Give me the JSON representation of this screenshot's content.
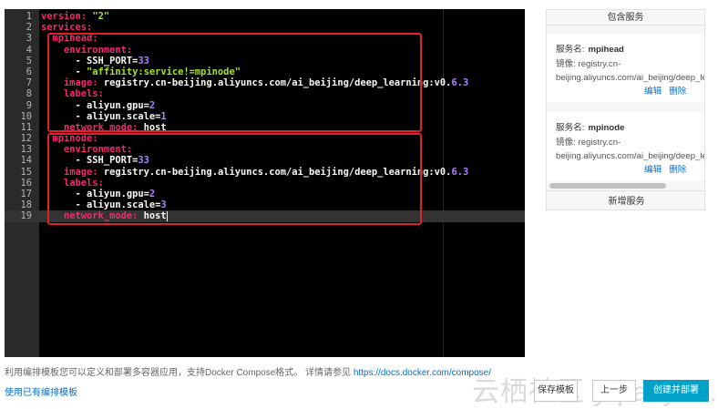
{
  "editor": {
    "lines": [
      {
        "num": "1",
        "segments": [
          {
            "c": "k",
            "t": "version: "
          },
          {
            "c": "s",
            "t": "\"2\""
          }
        ]
      },
      {
        "num": "2",
        "segments": [
          {
            "c": "k",
            "t": "services:"
          }
        ]
      },
      {
        "num": "3",
        "segments": [
          {
            "c": "w",
            "t": "  "
          },
          {
            "c": "k",
            "t": "mpihead:"
          }
        ]
      },
      {
        "num": "4",
        "segments": [
          {
            "c": "w",
            "t": "    "
          },
          {
            "c": "k",
            "t": "environment:"
          }
        ]
      },
      {
        "num": "5",
        "segments": [
          {
            "c": "w",
            "t": "      - SSH_PORT="
          },
          {
            "c": "n",
            "t": "33"
          }
        ]
      },
      {
        "num": "6",
        "segments": [
          {
            "c": "w",
            "t": "      - "
          },
          {
            "c": "s",
            "t": "\"affinity:service!=mpinode\""
          }
        ]
      },
      {
        "num": "7",
        "segments": [
          {
            "c": "w",
            "t": "    "
          },
          {
            "c": "k",
            "t": "image:"
          },
          {
            "c": "w",
            "t": " registry.cn-beijing.aliyuncs.com/ai_beijing/deep_learning:v0."
          },
          {
            "c": "n",
            "t": "6.3"
          }
        ]
      },
      {
        "num": "8",
        "segments": [
          {
            "c": "w",
            "t": "    "
          },
          {
            "c": "k",
            "t": "labels:"
          }
        ]
      },
      {
        "num": "9",
        "segments": [
          {
            "c": "w",
            "t": "      - aliyun.gpu="
          },
          {
            "c": "n",
            "t": "2"
          }
        ]
      },
      {
        "num": "10",
        "segments": [
          {
            "c": "w",
            "t": "      - aliyun.scale="
          },
          {
            "c": "n",
            "t": "1"
          }
        ]
      },
      {
        "num": "11",
        "segments": [
          {
            "c": "w",
            "t": "    "
          },
          {
            "c": "k",
            "t": "network_mode:"
          },
          {
            "c": "w",
            "t": " host"
          }
        ]
      },
      {
        "num": "12",
        "segments": [
          {
            "c": "w",
            "t": "  "
          },
          {
            "c": "k",
            "t": "mpinode:"
          }
        ]
      },
      {
        "num": "13",
        "segments": [
          {
            "c": "w",
            "t": "    "
          },
          {
            "c": "k",
            "t": "environment:"
          }
        ]
      },
      {
        "num": "14",
        "segments": [
          {
            "c": "w",
            "t": "      - SSH_PORT="
          },
          {
            "c": "n",
            "t": "33"
          }
        ]
      },
      {
        "num": "15",
        "segments": [
          {
            "c": "w",
            "t": "    "
          },
          {
            "c": "k",
            "t": "image:"
          },
          {
            "c": "w",
            "t": " registry.cn-beijing.aliyuncs.com/ai_beijing/deep_learning:v0."
          },
          {
            "c": "n",
            "t": "6.3"
          }
        ]
      },
      {
        "num": "16",
        "segments": [
          {
            "c": "w",
            "t": "    "
          },
          {
            "c": "k",
            "t": "labels:"
          }
        ]
      },
      {
        "num": "17",
        "segments": [
          {
            "c": "w",
            "t": "      - aliyun.gpu="
          },
          {
            "c": "n",
            "t": "2"
          }
        ]
      },
      {
        "num": "18",
        "segments": [
          {
            "c": "w",
            "t": "      - aliyun.scale="
          },
          {
            "c": "n",
            "t": "3"
          }
        ]
      },
      {
        "num": "19",
        "segments": [
          {
            "c": "w",
            "t": "    "
          },
          {
            "c": "k",
            "t": "network_mode:"
          },
          {
            "c": "w",
            "t": " host"
          }
        ],
        "active": true
      }
    ],
    "colors": {
      "keyword": "#f92672",
      "string": "#a6e22e",
      "number": "#ae81ff",
      "text": "#f8f8f2",
      "highlight_border": "#e0202a"
    }
  },
  "services_panel": {
    "title": "包含服务",
    "services": [
      {
        "name_label": "服务名:",
        "name": "mpihead",
        "image_label": "镜像:",
        "image_line1": "registry.cn-",
        "image_line2": "beijing.aliyuncs.com/ai_beijing/deep_lea",
        "edit": "编辑",
        "delete": "删除"
      },
      {
        "name_label": "服务名:",
        "name": "mpinode",
        "image_label": "镜像:",
        "image_line1": "registry.cn-",
        "image_line2": "beijing.aliyuncs.com/ai_beijing/deep_lea",
        "edit": "编辑",
        "delete": "删除"
      }
    ],
    "add_service": "新增服务"
  },
  "help": {
    "text": "利用编排模板您可以定义和部署多容器应用，支持Docker Compose格式。 详情请参见",
    "link": "https://docs.docker.com/compose/"
  },
  "use_existing": "使用已有编排模板",
  "buttons": {
    "save": "保存模板",
    "prev": "上一步",
    "create": "创建并部署",
    "create_color": "#00a2ca"
  },
  "watermark": "云栖社区 yq.aliyun.com"
}
